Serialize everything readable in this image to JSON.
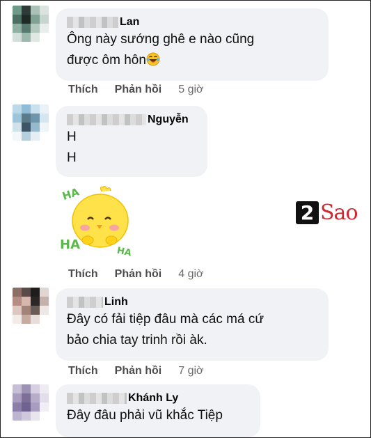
{
  "comments": [
    {
      "name": "Lan",
      "text": "Ông này sướng ghê e nào cũng\nđược ôm hôn",
      "emoji": "laughing-emoji",
      "like": "Thích",
      "reply": "Phản hồi",
      "time": "5 giờ"
    },
    {
      "name": "Nguyễn",
      "text": "H\nH",
      "sticker": "ha-ha-chick-sticker",
      "like": "Thích",
      "reply": "Phản hồi",
      "time": "4 giờ"
    },
    {
      "name": "Linh",
      "text": "Đây có fải tiệp đâu mà các má cứ\nbảo chia tay trinh rồi àk.",
      "like": "Thích",
      "reply": "Phản hồi",
      "time": "7 giờ"
    },
    {
      "name": "Khánh Ly",
      "text": "Đây đâu phải vũ khắc Tiệp"
    }
  ],
  "sticker_text": {
    "top": "HA",
    "left": "HA",
    "right": "HA"
  },
  "watermark": {
    "digit": "2",
    "word": "Sao"
  },
  "colors": {
    "bubble": "#f0f2f5",
    "action": "#4d4d4d",
    "brand_red": "#d4262f"
  }
}
